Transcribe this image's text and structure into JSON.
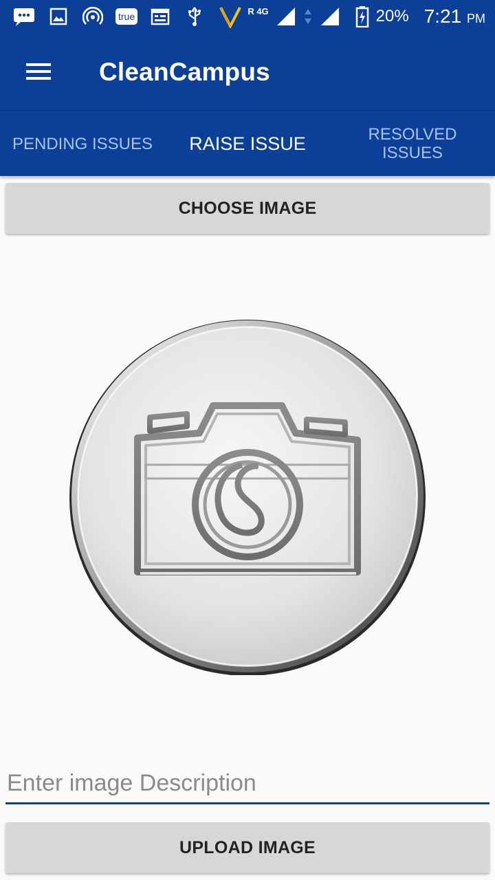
{
  "status_bar": {
    "icons": [
      "chat-icon",
      "gallery-icon",
      "hotspot-icon",
      "calendar-icon",
      "usb-icon",
      "vodafone-logo-icon",
      "signal-icon",
      "data-arrows-icon",
      "signal-full-icon",
      "battery-charging-icon"
    ],
    "true_badge": "true",
    "network_type": "R 4G",
    "battery": "20%",
    "time": "7:21",
    "ampm": "PM"
  },
  "app_bar": {
    "title": "CleanCampus",
    "menu_icon": "hamburger-menu-icon"
  },
  "tabs": [
    {
      "label": "PENDING ISSUES",
      "active": false
    },
    {
      "label": "RAISE ISSUE",
      "active": true
    },
    {
      "label": "RESOLVED ISSUES",
      "active": false
    }
  ],
  "main": {
    "choose_button": "CHOOSE IMAGE",
    "image_placeholder_icon": "camera-icon",
    "description_placeholder": "Enter image Description",
    "description_value": "",
    "upload_button": "UPLOAD IMAGE"
  },
  "colors": {
    "primary": "#0b3f98",
    "tab_inactive": "#a9c3ee",
    "button_bg": "#d6d7d7",
    "background": "#fafafa"
  }
}
